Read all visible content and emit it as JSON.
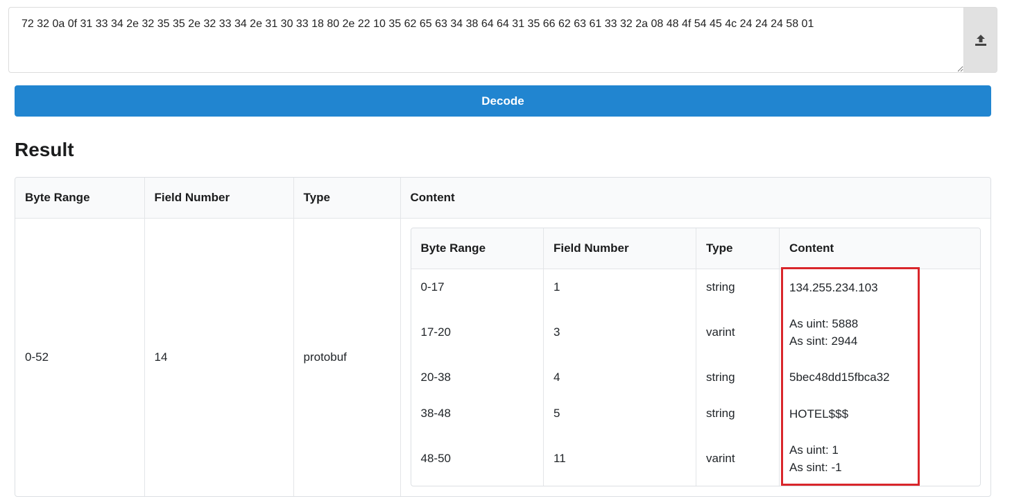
{
  "input": {
    "value": "72 32 0a 0f 31 33 34 2e 32 35 35 2e 32 33 34 2e 31 30 33 18 80 2e 22 10 35 62 65 63 34 38 64 64 31 35 66 62 63 61 33 32 2a 08 48 4f 54 45 4c 24 24 24 58 01"
  },
  "upload_icon": "upload-icon",
  "decode_label": "Decode",
  "result_title": "Result",
  "columns": [
    "Byte Range",
    "Field Number",
    "Type",
    "Content"
  ],
  "outer_row": {
    "byte_range": "0-52",
    "field_number": "14",
    "type": "protobuf"
  },
  "inner_rows": [
    {
      "byte_range": "0-17",
      "field_number": "1",
      "type": "string",
      "content": [
        "134.255.234.103"
      ]
    },
    {
      "byte_range": "17-20",
      "field_number": "3",
      "type": "varint",
      "content": [
        "As uint: 5888",
        "As sint: 2944"
      ]
    },
    {
      "byte_range": "20-38",
      "field_number": "4",
      "type": "string",
      "content": [
        "5bec48dd15fbca32"
      ]
    },
    {
      "byte_range": "38-48",
      "field_number": "5",
      "type": "string",
      "content": [
        "HOTEL$$$"
      ]
    },
    {
      "byte_range": "48-50",
      "field_number": "11",
      "type": "varint",
      "content": [
        "As uint: 1",
        "As sint: -1"
      ]
    }
  ],
  "colors": {
    "primary": "#2185d0",
    "highlight": "#d9262b",
    "header_bg": "#f9fafb"
  }
}
